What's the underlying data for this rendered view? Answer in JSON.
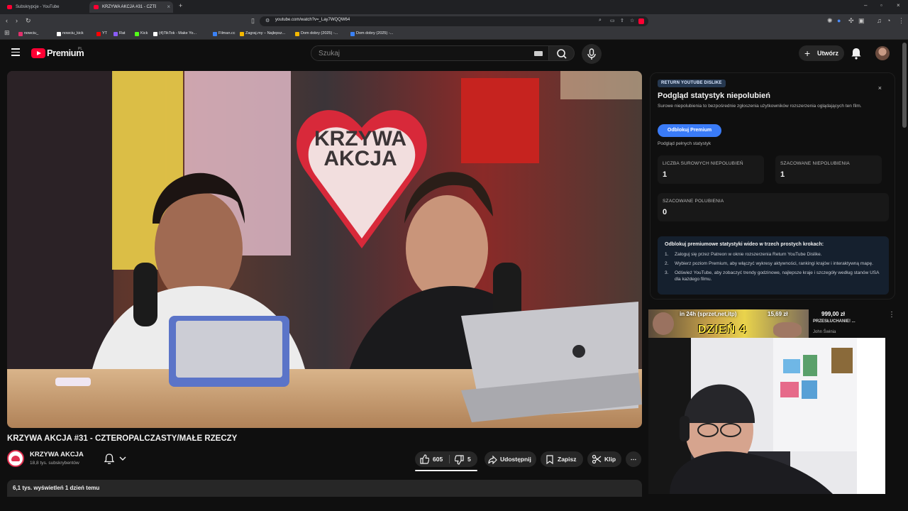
{
  "browser": {
    "tabs": [
      {
        "title": "Subskrypcje - YouTube",
        "active": false
      },
      {
        "title": "KRZYWA AKCJA #31 - CZTEROPALCZASTY/MAŁE RZECZY",
        "active": true
      }
    ],
    "url": "youtube.com/watch?v=_Lay7WQQW64",
    "bookmarks": [
      {
        "label": "nowciu_",
        "icon": "instagram-icon",
        "color": "#e1306c"
      },
      {
        "label": "nowciu_kick",
        "icon": "x-icon",
        "color": "#ffffff"
      },
      {
        "label": "YT",
        "icon": "youtube-icon",
        "color": "#ff0000"
      },
      {
        "label": "Rat",
        "icon": "bookmark-icon",
        "color": "#8a5cf6"
      },
      {
        "label": "Kick",
        "icon": "kick-icon",
        "color": "#53fc18"
      },
      {
        "label": "(4)TikTok - Make Yo...",
        "icon": "tiktok-icon",
        "color": "#ffffff"
      },
      {
        "label": "Filman.cc",
        "icon": "film-icon",
        "color": "#3b82f6"
      },
      {
        "label": "Zagraj.my – Najlepsz...",
        "icon": "game-icon",
        "color": "#f5b800"
      },
      {
        "label": "Dom dobry (2025) -...",
        "icon": "film-icon",
        "color": "#f5b800"
      },
      {
        "label": "Dom dobry (2025) -...",
        "icon": "film-icon",
        "color": "#3b82f6"
      }
    ]
  },
  "header": {
    "brand": "Premium",
    "region": "PL",
    "search_placeholder": "Szukaj",
    "create_label": "Utwórz"
  },
  "video": {
    "title": "KRZYWA AKCJA #31 - CZTEROPALCZASTY/MAŁE RZECZY",
    "channel": "KRZYWA AKCJA",
    "subscribers": "18,8 tys. subskrybentów",
    "likes": "605",
    "dislikes": "5",
    "share_label": "Udostępnij",
    "save_label": "Zapisz",
    "clip_label": "Klip",
    "more_label": "⋯",
    "views_date": "6,1 tys. wyświetleń  1 dzień temu",
    "thumbnail_sign": "KRZYWA\nAKCJA"
  },
  "ryd": {
    "badge": "RETURN YOUTUBE DISLIKE",
    "close": "×",
    "title": "Podgląd statystyk niepolubień",
    "description": "Surowe niepolubienia to bezpośrednie zgłoszenia użytkowników rozszerzenia oglądających ten film.",
    "unlock_label": "Odblokuj Premium",
    "preview_label": "Podgląd pełnych statystyk",
    "stats": [
      {
        "label": "LICZBA SUROWYCH NIEPOLUBIEŃ",
        "value": "1"
      },
      {
        "label": "SZACOWANE NIEPOLUBIENIA",
        "value": "1"
      },
      {
        "label": "SZACOWANE POLUBIENIA",
        "value": "0"
      }
    ],
    "steps_title": "Odblokuj premiumowe statystyki wideo w trzech prostych krokach:",
    "steps": [
      {
        "n": "1.",
        "text": "Zaloguj się przez Patreon w oknie rozszerzenia Return YouTube Dislike."
      },
      {
        "n": "2.",
        "text": "Wybierz poziom Premium, aby włączyć wykresy aktywności, rankingi krajów i interaktywną mapę."
      },
      {
        "n": "3.",
        "text": "Odśwież YouTube, aby zobaczyć trendy godzinowe, najlepsze kraje i szczegóły według stanów USA dla każdego filmu."
      }
    ]
  },
  "recommended": {
    "thumb_head": "in 24h (sprzet,net,itp)",
    "thumb_price": "15,69 zł",
    "thumb_big": "DZIEŃ 4",
    "price": "999,00 zł",
    "subtitle": "PRZESŁUCHANIE! ...",
    "channel": "John Świnia"
  },
  "colors": {
    "accent": "#3a7bf7",
    "youtube_red": "#ff0033",
    "background": "#0f0f0f"
  }
}
